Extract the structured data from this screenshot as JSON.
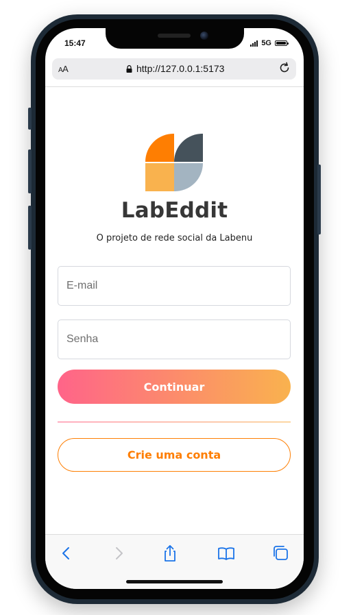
{
  "status_bar": {
    "time": "15:47",
    "network": "5G"
  },
  "browser": {
    "text_size_label_small": "A",
    "text_size_label_large": "A",
    "url": "http://127.0.0.1:5173",
    "toolbar_icons": [
      "back-icon",
      "forward-icon",
      "share-icon",
      "bookmarks-icon",
      "tabs-icon"
    ]
  },
  "login": {
    "logo_colors": {
      "orange": "#FE7E02",
      "light_orange": "#F9B24E",
      "dark_slate": "#45525B",
      "light_slate": "#A3B4C1"
    },
    "app_title": "LabEddit",
    "subtitle": "O projeto de rede social da Labenu",
    "email_placeholder": "E-mail",
    "password_placeholder": "Senha",
    "continue_label": "Continuar",
    "signup_label": "Crie uma conta",
    "gradient_start": "#FF6489",
    "gradient_end": "#F9B24E"
  }
}
